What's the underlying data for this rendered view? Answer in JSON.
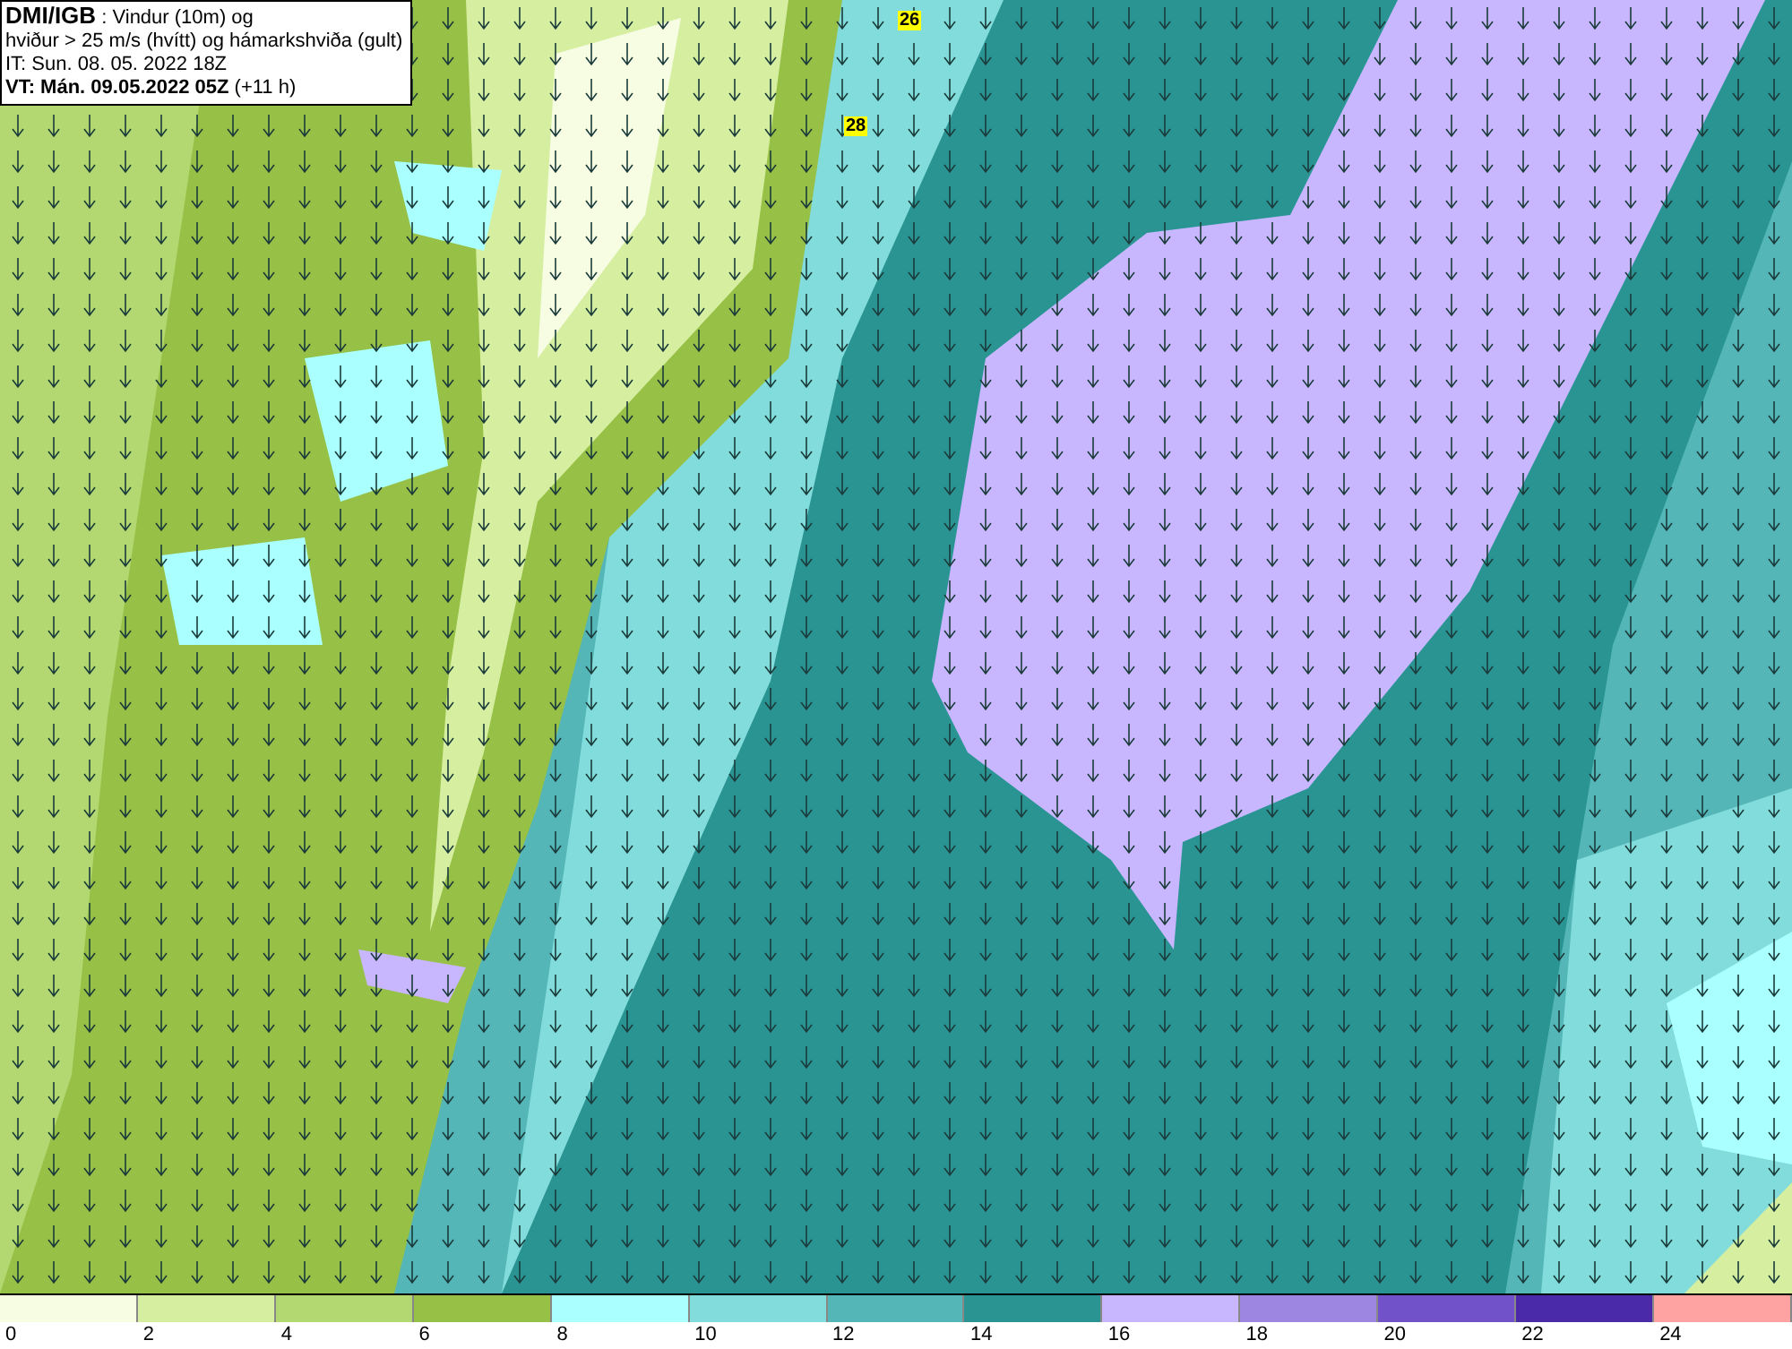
{
  "header": {
    "source": "DMI/IGB",
    "title": ": Vindur (10m) og",
    "subtitle": "hviður > 25 m/s (hvítt) og hámarkshviða (gult)",
    "initial_time": "IT: Sun. 08. 05. 2022 18Z",
    "valid_time": "VT: Mán. 09.05.2022 05Z",
    "offset": "(+11 h)"
  },
  "gust_labels": [
    {
      "value": "26"
    },
    {
      "value": "28"
    }
  ],
  "legend": [
    {
      "label": "0",
      "color": "#f6fde2"
    },
    {
      "label": "2",
      "color": "#d6eea0"
    },
    {
      "label": "4",
      "color": "#b3d872"
    },
    {
      "label": "6",
      "color": "#97c046"
    },
    {
      "label": "8",
      "color": "#aaffff"
    },
    {
      "label": "10",
      "color": "#82dcdc"
    },
    {
      "label": "12",
      "color": "#54b6b6"
    },
    {
      "label": "14",
      "color": "#2a9492"
    },
    {
      "label": "16",
      "color": "#c8b6ff"
    },
    {
      "label": "18",
      "color": "#9c86e2"
    },
    {
      "label": "20",
      "color": "#7152c8"
    },
    {
      "label": "22",
      "color": "#4a2aa8"
    },
    {
      "label": "24",
      "color": "#ffa2a2"
    }
  ]
}
